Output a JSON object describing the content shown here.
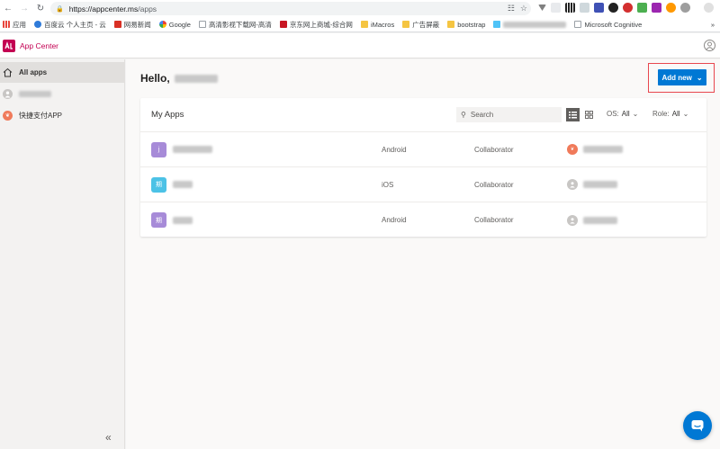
{
  "browser": {
    "url_host": "https://appcenter.ms",
    "url_path": "/apps"
  },
  "bookmarks": [
    {
      "label": "应用",
      "color": "#e8453c"
    },
    {
      "label": "百度云 个人主页 - 云",
      "color": "#2f7bd9"
    },
    {
      "label": "网易新闻",
      "color": "#d93025"
    },
    {
      "label": "Google",
      "color": "#4285f4"
    },
    {
      "label": "高清影视下载网-高清",
      "color": "#9aa0a6"
    },
    {
      "label": "京东网上商城-综合网",
      "color": "#c81623"
    },
    {
      "label": "iMacros",
      "color": "#f5c542"
    },
    {
      "label": "广告屏蔽",
      "color": "#f5c542"
    },
    {
      "label": "bootstrap",
      "color": "#f5c542"
    },
    {
      "label": "Microsoft Cognitive",
      "color": "#9aa0a6"
    }
  ],
  "appbar": {
    "brand": "App Center"
  },
  "sidebar": {
    "items": [
      {
        "label": "All apps",
        "icon": "home-icon"
      },
      {
        "label": "",
        "icon": "user-icon"
      },
      {
        "label": "快捷支付APP",
        "icon": "app-avatar-icon"
      }
    ]
  },
  "main": {
    "greeting": "Hello,",
    "add_new_label": "Add new",
    "card_title": "My Apps",
    "search_placeholder": "Search",
    "os_filter_label": "OS:",
    "os_filter_value": "All",
    "role_filter_label": "Role:",
    "role_filter_value": "All",
    "apps": [
      {
        "icon_letter": "j",
        "icon_color": "#a78bd8",
        "os": "Android",
        "role": "Collaborator",
        "owner_color": "#f07a5a"
      },
      {
        "icon_letter": "期",
        "icon_color": "#4cc2e6",
        "os": "iOS",
        "role": "Collaborator",
        "owner_color": "#c8c6c4"
      },
      {
        "icon_letter": "期",
        "icon_color": "#a78bd8",
        "os": "Android",
        "role": "Collaborator",
        "owner_color": "#c8c6c4"
      }
    ]
  },
  "colors": {
    "accent": "#0078d4",
    "brand": "#c30052",
    "highlight": "#e8474f"
  }
}
